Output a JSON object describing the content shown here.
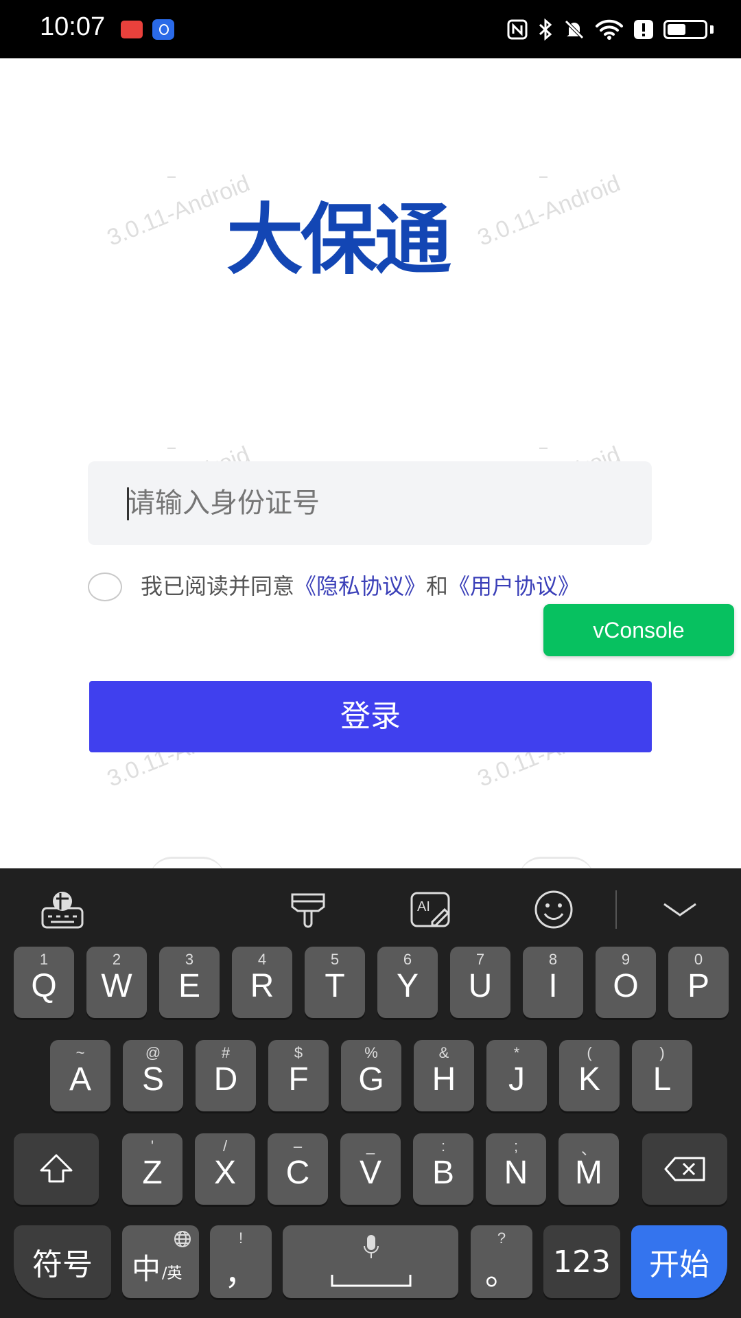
{
  "status_bar": {
    "time": "10:07",
    "icons": [
      "notification-app-icon",
      "bulb-app-icon",
      "nfc-icon",
      "bluetooth-icon",
      "mute-icon",
      "wifi-icon",
      "alert-icon",
      "battery-icon"
    ]
  },
  "watermark": "3.0.11-Android",
  "logo": "大保通",
  "id_input": {
    "placeholder": "请输入身份证号",
    "value": ""
  },
  "agreement": {
    "prefix": "我已阅读并同意",
    "privacy_link": "《隐私协议》",
    "conjunction": "和",
    "user_link": "《用户协议》",
    "checked": false
  },
  "vconsole_label": "vConsole",
  "login_button": "登录",
  "keyboard": {
    "toolbar": [
      "keyboard-settings-icon",
      "theme-brush-icon",
      "ai-write-icon",
      "emoji-icon",
      "collapse-keyboard-icon"
    ],
    "row1": [
      {
        "main": "Q",
        "sub": "1"
      },
      {
        "main": "W",
        "sub": "2"
      },
      {
        "main": "E",
        "sub": "3"
      },
      {
        "main": "R",
        "sub": "4"
      },
      {
        "main": "T",
        "sub": "5"
      },
      {
        "main": "Y",
        "sub": "6"
      },
      {
        "main": "U",
        "sub": "7"
      },
      {
        "main": "I",
        "sub": "8"
      },
      {
        "main": "O",
        "sub": "9"
      },
      {
        "main": "P",
        "sub": "0"
      }
    ],
    "row2": [
      {
        "main": "A",
        "sub": "~"
      },
      {
        "main": "S",
        "sub": "@"
      },
      {
        "main": "D",
        "sub": "#"
      },
      {
        "main": "F",
        "sub": "$"
      },
      {
        "main": "G",
        "sub": "%"
      },
      {
        "main": "H",
        "sub": "&"
      },
      {
        "main": "J",
        "sub": "*"
      },
      {
        "main": "K",
        "sub": "("
      },
      {
        "main": "L",
        "sub": ")"
      }
    ],
    "row3": [
      {
        "main": "Z",
        "sub": "'"
      },
      {
        "main": "X",
        "sub": "/"
      },
      {
        "main": "C",
        "sub": "–"
      },
      {
        "main": "V",
        "sub": "_"
      },
      {
        "main": "B",
        "sub": ":"
      },
      {
        "main": "N",
        "sub": ";"
      },
      {
        "main": "M",
        "sub": "、"
      }
    ],
    "symbols_key": "符号",
    "lang_key_main": "中",
    "lang_key_sub": "/英",
    "comma_main": "，",
    "comma_sub": "!",
    "period_main": "。",
    "period_sub": "?",
    "numbers_key": "123",
    "enter_key": "开始"
  }
}
